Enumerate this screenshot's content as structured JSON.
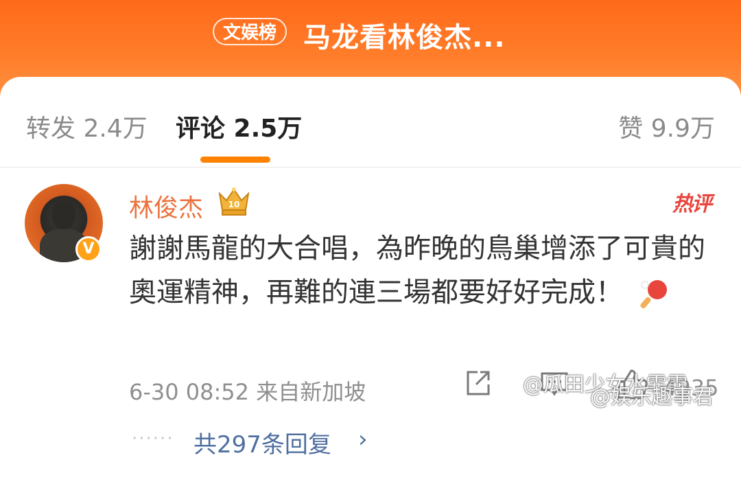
{
  "header": {
    "badge": "文娱榜",
    "title": "马龙看林俊杰..."
  },
  "tabs": {
    "repost": "转发 2.4万",
    "comment": "评论 2.5万",
    "like": "赞 9.9万"
  },
  "comment": {
    "username": "林俊杰",
    "hot_label": "热评",
    "text": "謝謝馬龍的大合唱，為昨晚的鳥巢增添了可貴的奧運精神，再難的連三場都要好好完成！",
    "time_location": "6-30 08:52 来自新加坡",
    "like_count": "4935",
    "verified_mark": "V",
    "crown_level": "10",
    "replies_dots": "······",
    "replies": "共297条回复",
    "replies_chevron": "›"
  },
  "watermark": {
    "line1": "@瓜田少女水霏霏",
    "line2": "@娱乐趣事君"
  },
  "colors": {
    "header_orange": "#ff6a1a",
    "tab_indicator": "#ff8200",
    "username": "#eb7340",
    "hot_red": "#e8453c",
    "link_blue": "#4f6fa0"
  },
  "icons": [
    "crown-icon",
    "hot-comment-icon",
    "share-icon",
    "comment-icon",
    "like-icon",
    "pingpong-icon",
    "verified-icon",
    "chevron-right-icon"
  ]
}
